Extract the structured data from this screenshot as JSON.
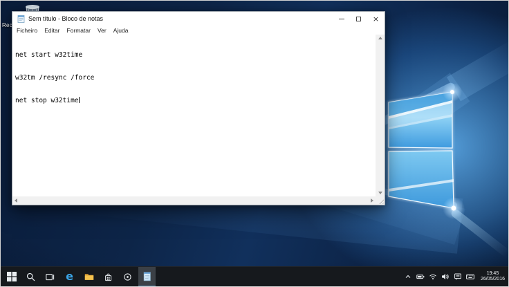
{
  "desktop": {
    "recycle_bin_label": "Reciclagem",
    "wallpaper": "windows-10-hero-blue",
    "colors": {
      "wallpaper_dark": "#0a1c3a",
      "logo_blue": "#45a3e2",
      "glow_white": "#eaf7ff"
    }
  },
  "window": {
    "title": "Sem título - Bloco de notas",
    "menu": [
      "Ficheiro",
      "Editar",
      "Formatar",
      "Ver",
      "Ajuda"
    ],
    "controls": {
      "close_glyph": "×",
      "buttons": [
        "minimize",
        "maximize",
        "close"
      ]
    },
    "lines": [
      "net start w32time",
      "w32tm /resync /force",
      "net stop w32time"
    ]
  },
  "taskbar": {
    "apps": [
      "start",
      "search",
      "task-view",
      "edge",
      "file-explorer",
      "store",
      "circular-app",
      "notepad"
    ],
    "active_app": "notepad",
    "edge_glyph": "e",
    "tray_icons": [
      "hidden-icons-chevron",
      "battery",
      "wifi",
      "volume",
      "action-center",
      "touch-keyboard"
    ],
    "clock": {
      "time": "19:45",
      "date": "26/05/2016"
    },
    "colors": {
      "taskbar_bg": "#16191d",
      "active_highlight": "#3b4046",
      "edge_blue": "#3ba7e9",
      "folder_yellow": "#f5c34f"
    }
  }
}
